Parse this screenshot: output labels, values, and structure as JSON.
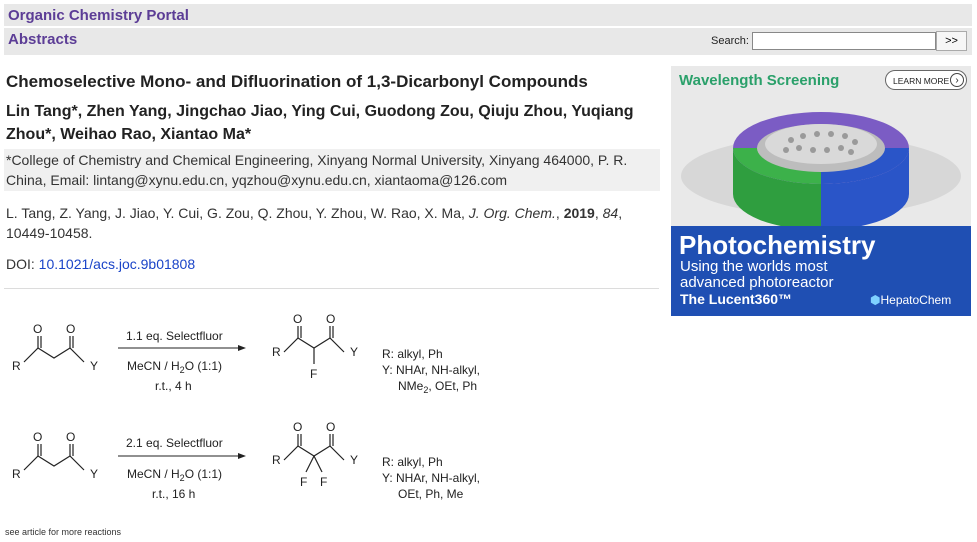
{
  "header": {
    "portal_title": "Organic Chemistry Portal",
    "section_title": "Abstracts",
    "search_label": "Search:",
    "search_value": "",
    "search_button": ">>"
  },
  "article": {
    "title": "Chemoselective Mono- and Difluorination of 1,3-Dicarbonyl Compounds",
    "authors": "Lin Tang*, Zhen Yang, Jingchao Jiao, Ying Cui, Guodong Zou, Qiuju Zhou, Yuqiang Zhou*, Weihao Rao, Xiantao Ma*",
    "affiliation": "*College of Chemistry and Chemical Engineering, Xinyang Normal University, Xinyang 464000, P. R. China, Email: lintang@xynu.edu.cn, yqzhou@xynu.edu.cn, xiantaoma@126.com",
    "citation_authors": "L. Tang, Z. Yang, J. Jiao, Y. Cui, G. Zou, Q. Zhou, Y. Zhou, W. Rao, X. Ma, ",
    "citation_journal": "J. Org. Chem.",
    "citation_year": "2019",
    "citation_volume": "84",
    "citation_pages": ", 10449-10458.",
    "doi_label": "DOI: ",
    "doi_value": "10.1021/acs.joc.9b01808"
  },
  "ad": {
    "headline": "Wavelength Screening",
    "learn_more": "LEARN MORE",
    "big": "Photochemistry",
    "sub1": "Using the worlds most",
    "sub2": "advanced photoreactor",
    "sub3": "The Lucent360™",
    "brand": "HepatoChem",
    "colors": {
      "blue": "#1f4fb3",
      "green": "#2aa06a",
      "purple": "#7b5cc4"
    }
  },
  "scheme": {
    "r1": {
      "reagent": "1.1 eq. Selectfluor",
      "solvent": "MeCN / H2O (1:1)",
      "conditions": "r.t., 4 h",
      "scope_r": "R: alkyl, Ph",
      "scope_y1": "Y: NHAr, NH-alkyl,",
      "scope_y2": "NMe2, OEt, Ph"
    },
    "r2": {
      "reagent": "2.1 eq. Selectfluor",
      "solvent": "MeCN / H2O (1:1)",
      "conditions": "r.t., 16 h",
      "scope_r": "R: alkyl, Ph",
      "scope_y1": "Y: NHAr, NH-alkyl,",
      "scope_y2": "OEt, Ph, Me"
    },
    "atoms": {
      "o": "O",
      "r": "R",
      "y": "Y",
      "f": "F"
    },
    "footnote": "see article for more reactions"
  }
}
